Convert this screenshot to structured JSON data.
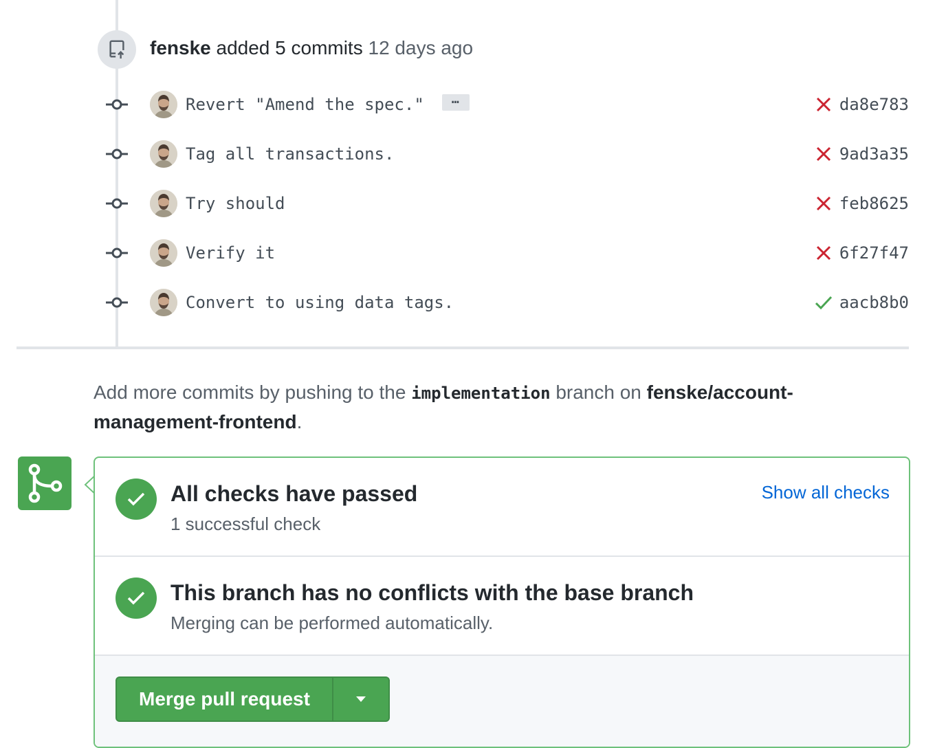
{
  "push_event": {
    "author": "fenske",
    "verb": "added 5 commits",
    "time": "12 days ago"
  },
  "commits": [
    {
      "message": "Revert \"Amend the spec.\"",
      "has_more": true,
      "more_label": "…",
      "status": "failure",
      "sha": "da8e783"
    },
    {
      "message": "Tag all transactions.",
      "has_more": false,
      "status": "failure",
      "sha": "9ad3a35"
    },
    {
      "message": "Try should",
      "has_more": false,
      "status": "failure",
      "sha": "feb8625"
    },
    {
      "message": "Verify it",
      "has_more": false,
      "status": "failure",
      "sha": "6f27f47"
    },
    {
      "message": "Convert to using data tags.",
      "has_more": false,
      "status": "success",
      "sha": "aacb8b0"
    }
  ],
  "push_hint": {
    "prefix": "Add more commits by pushing to the",
    "branch": "implementation",
    "middle": "branch on",
    "repo": "fenske/account-management-frontend",
    "suffix": "."
  },
  "merge_box": {
    "checks": {
      "title": "All checks have passed",
      "subtitle": "1 successful check",
      "link": "Show all checks"
    },
    "conflicts": {
      "title": "This branch has no conflicts with the base branch",
      "subtitle": "Merging can be performed automatically."
    },
    "merge_button": "Merge pull request"
  },
  "colors": {
    "success": "#4aa552",
    "failure": "#cb2431",
    "link": "#0366d6"
  },
  "icons": {
    "push": "repo-push-icon",
    "commit": "git-commit-icon",
    "failure": "x-icon",
    "success": "check-icon",
    "merge": "git-merge-icon",
    "caret": "triangle-down-icon"
  }
}
